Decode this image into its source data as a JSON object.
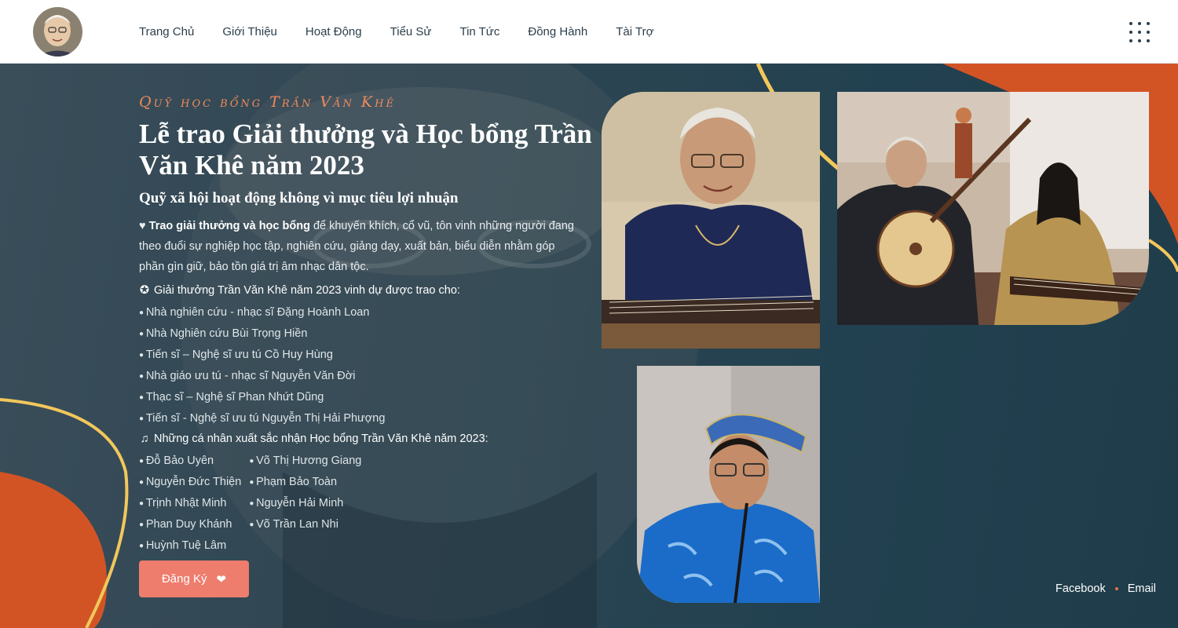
{
  "header": {
    "nav": [
      "Trang Chủ",
      "Giới Thiệu",
      "Hoạt Động",
      "Tiểu Sử",
      "Tin Tức",
      "Đồng Hành",
      "Tài Trợ"
    ]
  },
  "hero": {
    "eyebrow": "Quỹ học bổng Trần Văn Khê",
    "title": "Lễ trao Giải thưởng và Học bổng Trần Văn Khê năm 2023",
    "subtitle": "Quỹ xã hội hoạt động không vì mục tiêu lợi nhuận",
    "intro_bold": "Trao giải thưởng và học bổng",
    "intro_rest": " để khuyến khích, cổ vũ, tôn vinh những người đang theo đuổi sự nghiệp học tập, nghiên cứu, giảng dạy, xuất bản, biểu diễn nhằm góp phần gìn giữ, bảo tồn giá trị âm nhạc dân tộc.",
    "awards_heading": "Giải thưởng Trần Văn Khê năm 2023 vinh dự được trao cho:",
    "awards": [
      "Nhà nghiên cứu - nhạc sĩ Đặng Hoành Loan",
      "Nhà Nghiên cứu Bùi Trọng Hiền",
      "Tiến sĩ – Nghệ sĩ ưu tú Cồ Huy Hùng",
      "Nhà giáo ưu tú - nhạc sĩ Nguyễn Văn Đời",
      "Thạc sĩ – Nghệ sĩ Phan Nhứt Dũng",
      "Tiến sĩ - Nghệ sĩ ưu tú Nguyễn Thị Hải Phượng"
    ],
    "scholars_heading": "Những cá nhân xuất sắc nhận Học bổng Trần Văn Khê năm 2023:",
    "scholars_col1": [
      "Đỗ Bảo Uyên",
      "Nguyễn Đức Thiện",
      "Trịnh Nhật Minh",
      "Phan Duy Khánh",
      "Huỳnh Tuệ Lâm"
    ],
    "scholars_col2": [
      "Võ Thị Hương Giang",
      "Phạm Bảo Toàn",
      "Nguyễn Hải Minh",
      "Võ Trần Lan Nhi"
    ],
    "cta": "Đăng Ký"
  },
  "social": {
    "facebook": "Facebook",
    "email": "Email"
  },
  "icons": {
    "heart": "heart-icon",
    "medal": "medal-icon",
    "music": "music-note-icon",
    "hand": "hand-heart-icon",
    "menu": "grid-menu-icon"
  },
  "colors": {
    "accent": "#ee7d6e",
    "eyebrow": "#ef8a5c",
    "orange": "#d25425",
    "yellow": "#f2c75c",
    "hero_bg": "#2a4350"
  }
}
